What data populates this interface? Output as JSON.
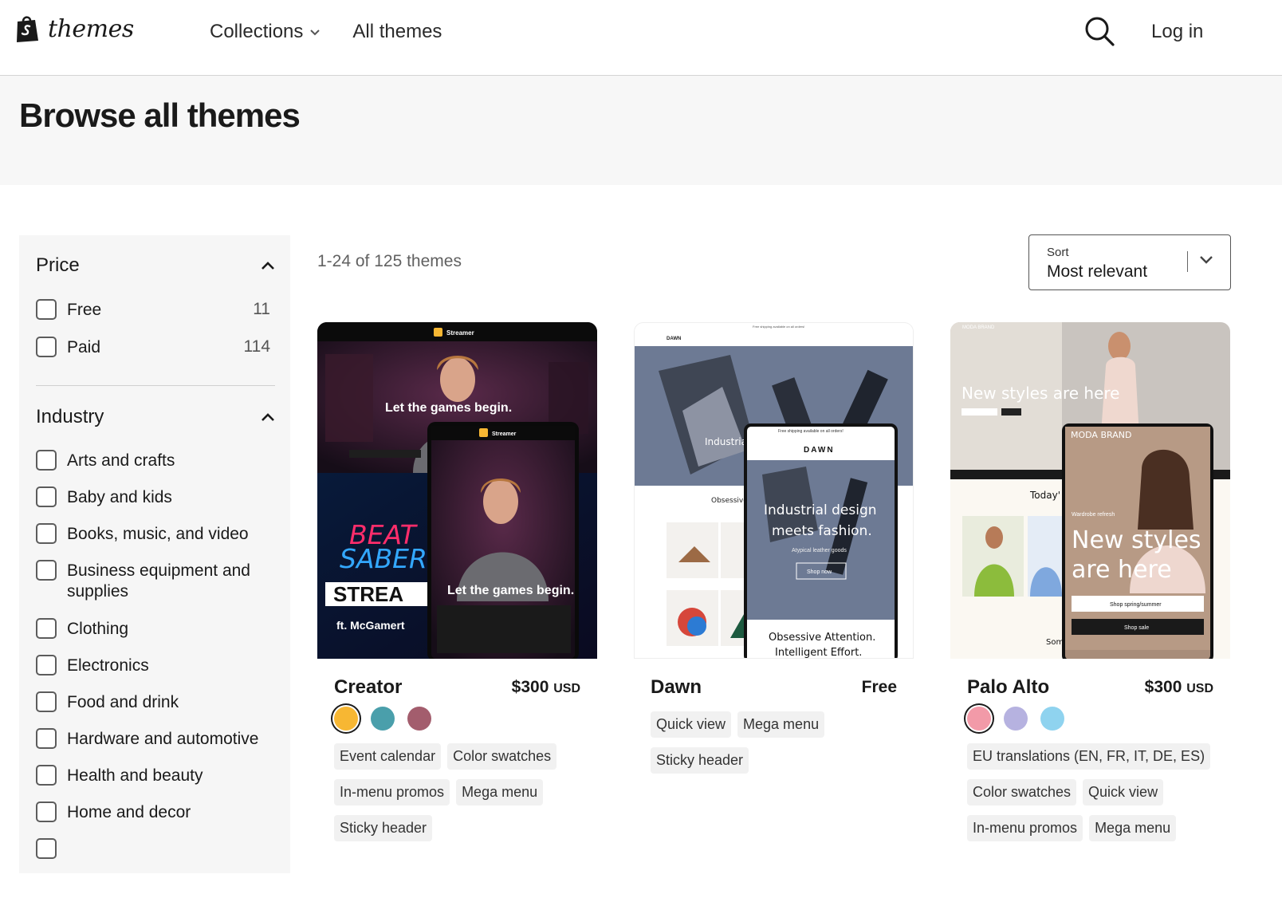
{
  "header": {
    "logo_text": "themes",
    "nav": [
      {
        "label": "Collections",
        "has_dropdown": true
      },
      {
        "label": "All themes",
        "has_dropdown": false
      }
    ],
    "search_icon": "search-icon",
    "login_label": "Log in"
  },
  "hero": {
    "title": "Browse all themes"
  },
  "filters": {
    "price": {
      "title": "Price",
      "options": [
        {
          "label": "Free",
          "count": "11"
        },
        {
          "label": "Paid",
          "count": "114"
        }
      ]
    },
    "industry": {
      "title": "Industry",
      "options": [
        {
          "label": "Arts and crafts"
        },
        {
          "label": "Baby and kids"
        },
        {
          "label": "Books, music, and video"
        },
        {
          "label": "Business equipment and supplies"
        },
        {
          "label": "Clothing"
        },
        {
          "label": "Electronics"
        },
        {
          "label": "Food and drink"
        },
        {
          "label": "Hardware and automotive"
        },
        {
          "label": "Health and beauty"
        },
        {
          "label": "Home and decor"
        }
      ]
    }
  },
  "results": {
    "count_text": "1-24 of 125 themes"
  },
  "sort": {
    "label": "Sort",
    "value": "Most relevant"
  },
  "themes": [
    {
      "name": "Creator",
      "price": "$300",
      "currency": "USD",
      "swatches": [
        "#f7b733",
        "#4a9fab",
        "#a35d6d"
      ],
      "selected_swatch": 0,
      "tags": [
        "Event calendar",
        "Color swatches",
        "In-menu promos",
        "Mega menu",
        "Sticky header"
      ],
      "preview": {
        "brand": "Streamer",
        "headline": "Let the games begin.",
        "beat_saber_1": "BEAT",
        "beat_saber_2": "SABER",
        "stream_text": "STREA",
        "ft_text": "ft. McGamert"
      }
    },
    {
      "name": "Dawn",
      "price": "Free",
      "currency": "",
      "swatches": [],
      "tags": [
        "Quick view",
        "Mega menu",
        "Sticky header"
      ],
      "preview": {
        "brand": "DAWN",
        "top_banner": "Free shipping available on all orders!",
        "headline_1": "Industrial design",
        "headline_2": "meets fashion.",
        "sub": "Atypical leather goods",
        "cta": "Shop now",
        "tagline_1": "Obsessive Attention.",
        "tagline_2": "Intelligent Effort.",
        "peek_industria": "Industria",
        "peek_obsessive": "Obsessive"
      }
    },
    {
      "name": "Palo Alto",
      "price": "$300",
      "currency": "USD",
      "swatches": [
        "#f29aa8",
        "#b6b2e0",
        "#8fd3ef"
      ],
      "selected_swatch": 0,
      "tags": [
        "EU translations (EN, FR, IT, DE, ES)",
        "Color swatches",
        "Quick view",
        "In-menu promos",
        "Mega menu"
      ],
      "preview": {
        "brand": "MODA BRAND",
        "eyebrow": "Wardrobe refresh",
        "headline_1": "New styles",
        "headline_2": "are here",
        "desktop_headline": "New styles are here",
        "cta_1": "Shop spring/summer",
        "cta_2": "Shop sale",
        "today": "Today'",
        "som": "Som"
      }
    }
  ]
}
